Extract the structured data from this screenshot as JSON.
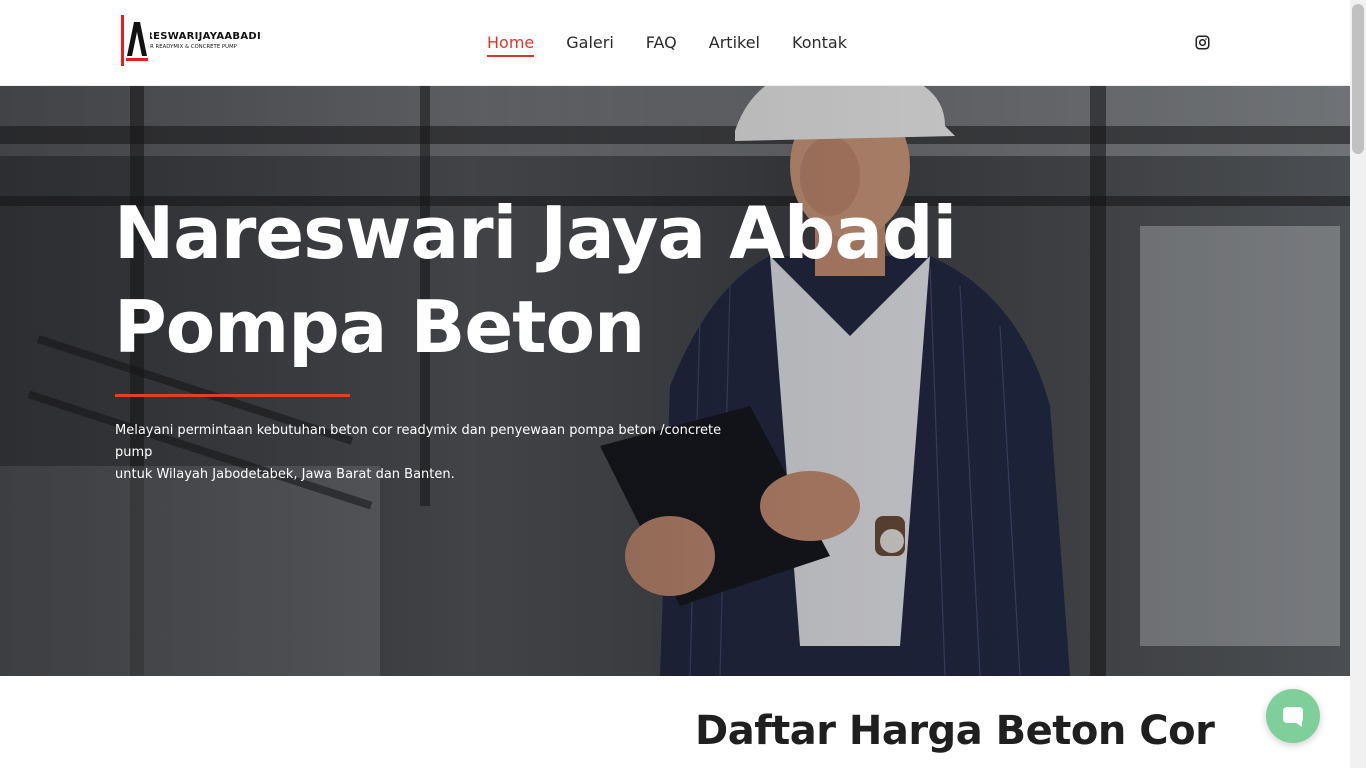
{
  "brand": {
    "name": "NARESWARIJAYAABADI",
    "tagline": "SUPPLIER READYMIX & CONCRETE PUMP",
    "accent": "#e31e24"
  },
  "nav": {
    "items": [
      {
        "label": "Home",
        "active": true
      },
      {
        "label": "Galeri",
        "active": false
      },
      {
        "label": "FAQ",
        "active": false
      },
      {
        "label": "Artikel",
        "active": false
      },
      {
        "label": "Kontak",
        "active": false
      }
    ],
    "active_color": "#d9372a",
    "social_icon": "instagram-icon"
  },
  "hero": {
    "title_line1": "Nareswari Jaya Abadi",
    "title_line2": "Pompa Beton",
    "description_line1": "Melayani permintaan kebutuhan beton cor readymix dan penyewaan pompa beton /concrete pump",
    "description_line2": "untuk Wilayah Jabodetabek, Jawa Barat dan Banten.",
    "divider_color": "#e3401d"
  },
  "section": {
    "title": "Daftar Harga Beton Cor"
  },
  "chat": {
    "icon": "chat-icon",
    "color": "#7fcf9a"
  }
}
